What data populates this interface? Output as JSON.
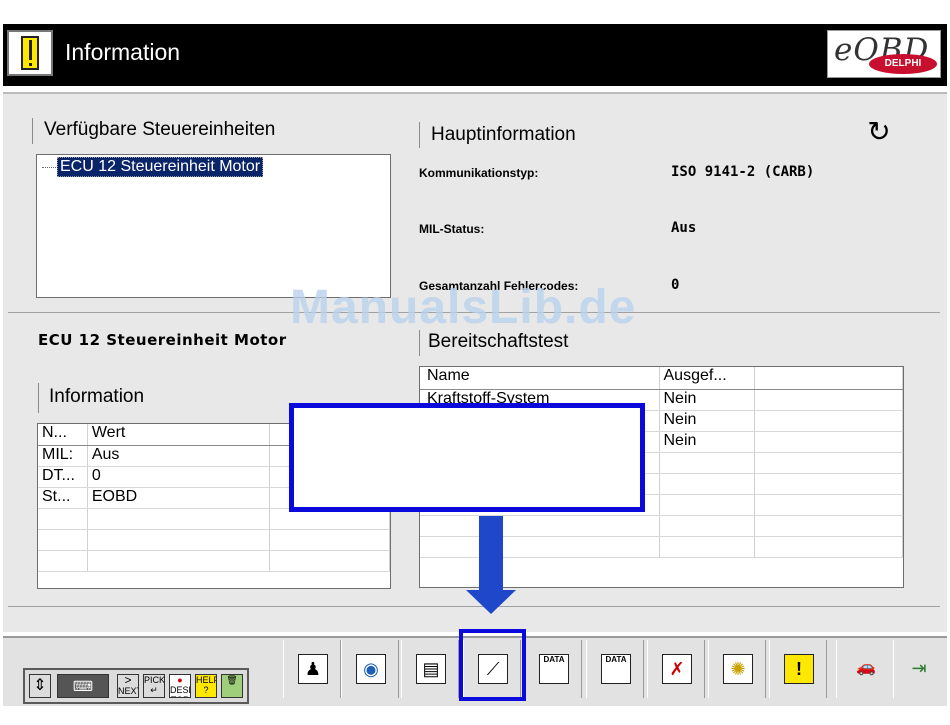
{
  "header": {
    "title": "Information",
    "logo_text": "eOBD",
    "logo_badge": "DELPHI"
  },
  "ecu_panel": {
    "title": "Verfügbare Steuereinheiten",
    "items": [
      "ECU 12 Steuereinheit Motor"
    ]
  },
  "main_info": {
    "title": "Hauptinformation",
    "fields": [
      {
        "label": "Kommunikationstyp:",
        "value": "ISO 9141-2 (CARB)"
      },
      {
        "label": "MIL-Status:",
        "value": "Aus"
      },
      {
        "label": "Gesamtanzahl Fehlercodes:",
        "value": "0"
      }
    ]
  },
  "selected_ecu": "ECU 12 Steuereinheit Motor",
  "info_table": {
    "title": "Information",
    "columns": [
      "N...",
      "Wert"
    ],
    "rows": [
      [
        "MIL:",
        "Aus"
      ],
      [
        "DT...",
        "0"
      ],
      [
        "St...",
        "EOBD"
      ]
    ]
  },
  "readiness": {
    "title": "Bereitschaftstest",
    "columns": [
      "Name",
      "Ausgef..."
    ],
    "rows": [
      [
        "Kraftstoff-System",
        "Nein"
      ],
      [
        "",
        "Nein"
      ],
      [
        "",
        "Nein"
      ]
    ]
  },
  "watermark": "ManualsLib.de",
  "toolbar": {
    "mini": [
      "NEXT",
      "PICK",
      "DESK TOP",
      "HELP"
    ],
    "buttons": [
      {
        "icon": "joystick-icon",
        "glyph": "♟"
      },
      {
        "icon": "eye-icon",
        "glyph": "◉"
      },
      {
        "icon": "folder-icon",
        "glyph": "▤"
      },
      {
        "icon": "spark-plug-icon",
        "glyph": "⟋"
      },
      {
        "icon": "data-stream-icon",
        "glyph": "DATA"
      },
      {
        "icon": "data-graph-icon",
        "glyph": "DATA"
      },
      {
        "icon": "erase-codes-icon",
        "glyph": "✗"
      },
      {
        "icon": "sensor-icon",
        "glyph": "✺"
      },
      {
        "icon": "warning-icon",
        "glyph": "!"
      },
      {
        "icon": "car-icon",
        "glyph": "🚗"
      },
      {
        "icon": "exit-icon",
        "glyph": "⇥"
      }
    ]
  },
  "colors": {
    "title_bg": "#000000",
    "panel_bg": "#e8e8e8",
    "selection": "#0a246a",
    "annotation": "#0a0adc",
    "arrow": "#1f47c9"
  }
}
